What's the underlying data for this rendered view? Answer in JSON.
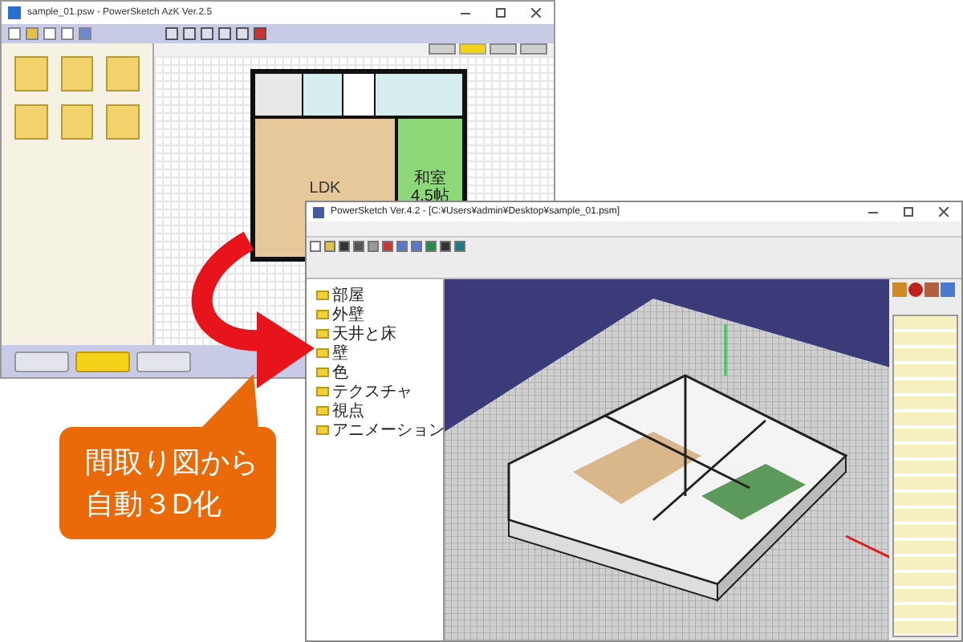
{
  "plan_window": {
    "title": "sample_01.psw - PowerSketch AzK Ver.2.5",
    "floor_tabs": [
      {
        "selected": false
      },
      {
        "selected": true
      },
      {
        "selected": false
      },
      {
        "selected": false
      }
    ],
    "rooms": [
      {
        "label": "LDK",
        "kind": "floor"
      },
      {
        "label": "和室",
        "kind": "tatami"
      },
      {
        "label": "4.5帖",
        "kind": "note"
      }
    ],
    "dock_buttons": [
      {
        "selected": false
      },
      {
        "selected": true
      },
      {
        "selected": false
      }
    ]
  },
  "model_window": {
    "title": "PowerSketch Ver.4.2 - [C:¥Users¥admin¥Desktop¥sample_01.psm]",
    "tree": [
      {
        "label": "部屋"
      },
      {
        "label": "外壁"
      },
      {
        "label": "天井と床"
      },
      {
        "label": "壁"
      },
      {
        "label": "色"
      },
      {
        "label": "テクスチャ"
      },
      {
        "label": "視点"
      },
      {
        "label": "アニメーション"
      }
    ]
  },
  "callout": {
    "lines": [
      "間取り図から",
      "自動３D化"
    ]
  }
}
